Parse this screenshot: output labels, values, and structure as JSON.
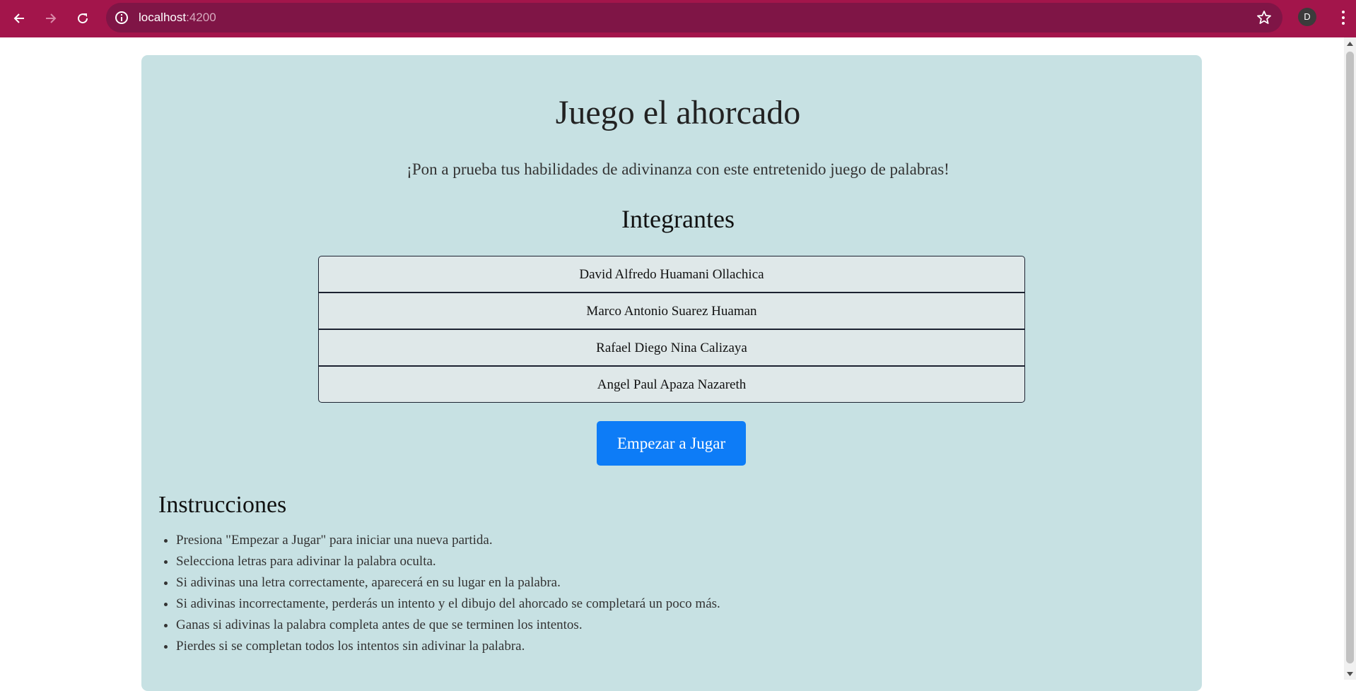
{
  "browser": {
    "url_host": "localhost",
    "url_port": ":4200",
    "profile_initial": "D",
    "icons": {
      "back": "arrow-left-icon",
      "forward": "arrow-right-icon",
      "reload": "reload-icon",
      "site_info": "info-icon",
      "bookmark": "star-icon",
      "menu": "kebab-menu-icon"
    }
  },
  "page": {
    "title": "Juego el ahorcado",
    "subtitle": "¡Pon a prueba tus habilidades de adivinanza con este entretenido juego de palabras!",
    "members_title": "Integrantes",
    "members": [
      "David Alfredo Huamani Ollachica",
      "Marco Antonio Suarez Huaman",
      "Rafael Diego Nina Calizaya",
      "Angel Paul Apaza Nazareth"
    ],
    "play_button": "Empezar a Jugar",
    "instructions_title": "Instrucciones",
    "instructions": [
      "Presiona \"Empezar a Jugar\" para iniciar una nueva partida.",
      "Selecciona letras para adivinar la palabra oculta.",
      "Si adivinas una letra correctamente, aparecerá en su lugar en la palabra.",
      "Si adivinas incorrectamente, perderás un intento y el dibujo del ahorcado se completará un poco más.",
      "Ganas si adivinas la palabra completa antes de que se terminen los intentos.",
      "Pierdes si se completan todos los intentos sin adivinar la palabra."
    ]
  },
  "colors": {
    "toolbar": "#a3154b",
    "omnibox": "#7f1546",
    "card": "#c7e1e3",
    "button": "#0d7cf7"
  }
}
